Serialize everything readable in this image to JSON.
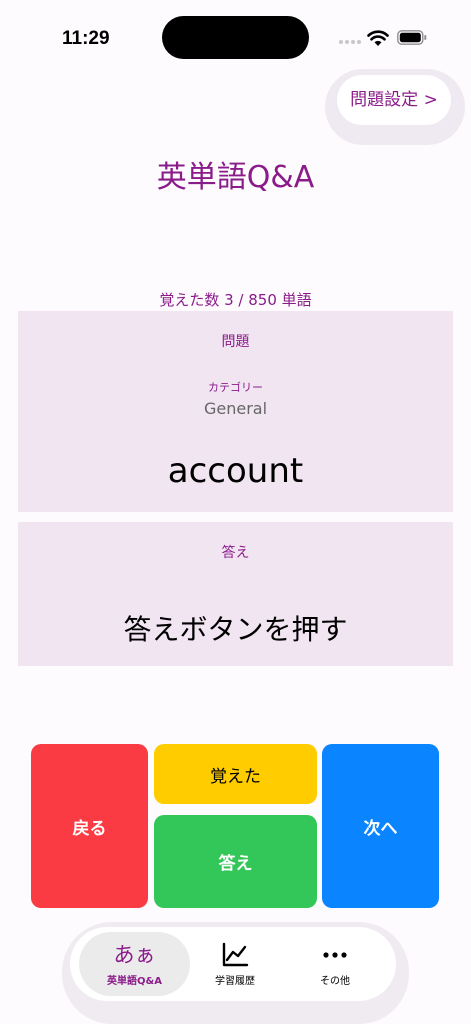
{
  "status_bar": {
    "time": "11:29"
  },
  "header": {
    "settings_button": "問題設定 >",
    "title": "英単語Q&A"
  },
  "progress": {
    "text": "覚えた数  3 / 850 単語",
    "learned": 3,
    "total": 850
  },
  "question_card": {
    "heading": "問題",
    "category_label": "カテゴリー",
    "category_value": "General",
    "word": "account"
  },
  "answer_card": {
    "heading": "答え",
    "text": "答えボタンを押す"
  },
  "buttons": {
    "back": "戻る",
    "memorized": "覚えた",
    "answer": "答え",
    "next": "次へ"
  },
  "tabbar": {
    "tabs": [
      {
        "icon_text": "あぁ",
        "label": "英単語Q&A",
        "icon": "kana-icon",
        "active": true
      },
      {
        "label": "学習履歴",
        "icon": "chart-icon",
        "active": false
      },
      {
        "label": "その他",
        "icon": "more-icon",
        "active": false
      }
    ]
  },
  "colors": {
    "accent": "#8a1c8a",
    "card_bg": "#f2e5f2",
    "back": "#fb3b43",
    "memorized": "#ffcc00",
    "answer": "#33c659",
    "next": "#0a84ff"
  }
}
